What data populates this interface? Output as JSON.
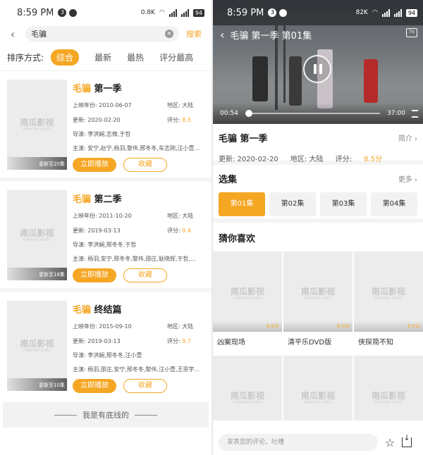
{
  "left": {
    "status": {
      "time": "8:59 PM",
      "badge": "3",
      "speed": "0.8K",
      "battery": "94"
    },
    "search": {
      "value": "毛骗",
      "search_label": "搜索"
    },
    "sort": {
      "label": "排序方式:",
      "options": [
        "综合",
        "最新",
        "最热",
        "评分最高"
      ],
      "active": "综合"
    },
    "results": [
      {
        "title_hl": "毛骗",
        "title_rest": " 第一季",
        "year": "上映年份: 2010-06-07",
        "region": "地区: 大陆",
        "updated": "更新: 2020-02-20",
        "score_label": "评分: ",
        "score": "8.5",
        "director": "导演: 李洪娴,志微,于哲",
        "cast": "主演: 安宁,赵宁,杨羽,黎伟,邢冬冬,车志刚,汪小壹...",
        "update_badge": "更新至20集"
      },
      {
        "title_hl": "毛骗",
        "title_rest": " 第二季",
        "year": "上映年份: 2011-10-20",
        "region": "地区: 大陆",
        "updated": "更新: 2019-03-13",
        "score_label": "评分: ",
        "score": "9.4",
        "director": "导演: 李洪娴,邢冬冬,于哲",
        "cast": "主演: 杨羽,安宁,邢冬冬,黎伟,邵庄,耿晓辉,于哲,...",
        "update_badge": "更新至16集"
      },
      {
        "title_hl": "毛骗",
        "title_rest": " 终结篇",
        "year": "上映年份: 2015-09-10",
        "region": "地区: 大陆",
        "updated": "更新: 2019-03-13",
        "score_label": "评分: ",
        "score": "9.7",
        "director": "导演: 李洪娴,邢冬冬,汪小壹",
        "cast": "主演: 杨羽,邵庄,安宁,邢冬冬,黎伟,汪小壹,王思宇...",
        "update_badge": "更新至10集"
      }
    ],
    "play_label": "立即播放",
    "fav_label": "收藏",
    "watermark_cn": "南瓜影视",
    "watermark_en": "PUMPKIN VIDEO",
    "bottom_text": "我是有底线的"
  },
  "right": {
    "status": {
      "time": "8:59 PM",
      "badge": "3",
      "speed": "82K",
      "battery": "94"
    },
    "player": {
      "title": "毛骗 第一季 第01集",
      "current_time": "00:54",
      "duration": "37:00",
      "progress": 0.024,
      "tv_label": "TV"
    },
    "info": {
      "name": "毛骗 第一季",
      "intro_label": "简介 ›",
      "updated": "更新: 2020-02-20",
      "region": "地区: 大陆",
      "score_label": "评分: ",
      "score": "8.5分"
    },
    "episodes": {
      "title": "选集",
      "more_label": "更多 ›",
      "items": [
        "第01集",
        "第02集",
        "第03集",
        "第04集"
      ],
      "active": "第01集"
    },
    "guess": {
      "title": "猜你喜欢",
      "items": [
        {
          "name": "凶案现场",
          "score": "6.0分"
        },
        {
          "name": "清平乐DVD版",
          "score": "6.0分"
        },
        {
          "name": "侠探简不知",
          "score": "6.0分"
        },
        {
          "name": "",
          "score": ""
        },
        {
          "name": "",
          "score": ""
        },
        {
          "name": "",
          "score": ""
        }
      ]
    },
    "comment_placeholder": "发表您的评论、吐槽",
    "accent": "#f5a623"
  }
}
